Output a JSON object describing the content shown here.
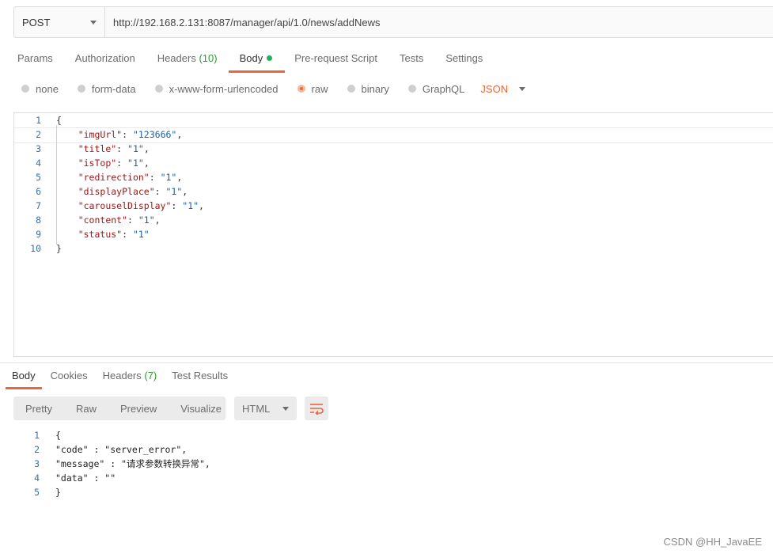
{
  "request": {
    "method": "POST",
    "url": "http://192.168.2.131:8087/manager/api/1.0/news/addNews"
  },
  "request_tabs": [
    {
      "label": "Params"
    },
    {
      "label": "Authorization"
    },
    {
      "label": "Headers",
      "count": "(10)"
    },
    {
      "label": "Body"
    },
    {
      "label": "Pre-request Script"
    },
    {
      "label": "Tests"
    },
    {
      "label": "Settings"
    }
  ],
  "body_types": [
    {
      "label": "none"
    },
    {
      "label": "form-data"
    },
    {
      "label": "x-www-form-urlencoded"
    },
    {
      "label": "raw"
    },
    {
      "label": "binary"
    },
    {
      "label": "GraphQL"
    }
  ],
  "format_select": "JSON",
  "request_body": {
    "line_numbers": [
      "1",
      "2",
      "3",
      "4",
      "5",
      "6",
      "7",
      "8",
      "9",
      "10"
    ],
    "open_brace": "{",
    "close_brace": "}",
    "fields": [
      {
        "key": "\"imgUrl\"",
        "value": "\"123666\"",
        "sep": ","
      },
      {
        "key": "\"title\"",
        "value": "\"1\"",
        "sep": ","
      },
      {
        "key": "\"isTop\"",
        "value": "\"1\"",
        "sep": ","
      },
      {
        "key": "\"redirection\"",
        "value": "\"1\"",
        "sep": ","
      },
      {
        "key": "\"displayPlace\"",
        "value": "\"1\"",
        "sep": ","
      },
      {
        "key": "\"carouselDisplay\"",
        "value": "\"1\"",
        "sep": ","
      },
      {
        "key": "\"content\"",
        "value": "\"1\"",
        "sep": ","
      },
      {
        "key": "\"status\"",
        "value": "\"1\"",
        "sep": ""
      }
    ]
  },
  "response_tabs": [
    {
      "label": "Body"
    },
    {
      "label": "Cookies"
    },
    {
      "label": "Headers",
      "count": "(7)"
    },
    {
      "label": "Test Results"
    }
  ],
  "view_modes": [
    "Pretty",
    "Raw",
    "Preview",
    "Visualize"
  ],
  "response_format": "HTML",
  "response_body": {
    "line_numbers": [
      "1",
      "2",
      "3",
      "4",
      "5"
    ],
    "lines": [
      "{",
      "\"code\" : \"server_error\",",
      "\"message\" : \"请求参数转换异常\",",
      "\"data\" : \"\"",
      "}"
    ]
  },
  "watermark": "CSDN @HH_JavaEE",
  "colors": {
    "accent": "#e8683a",
    "count_green": "#2a9d2a",
    "line_number": "#3c6ea8"
  }
}
